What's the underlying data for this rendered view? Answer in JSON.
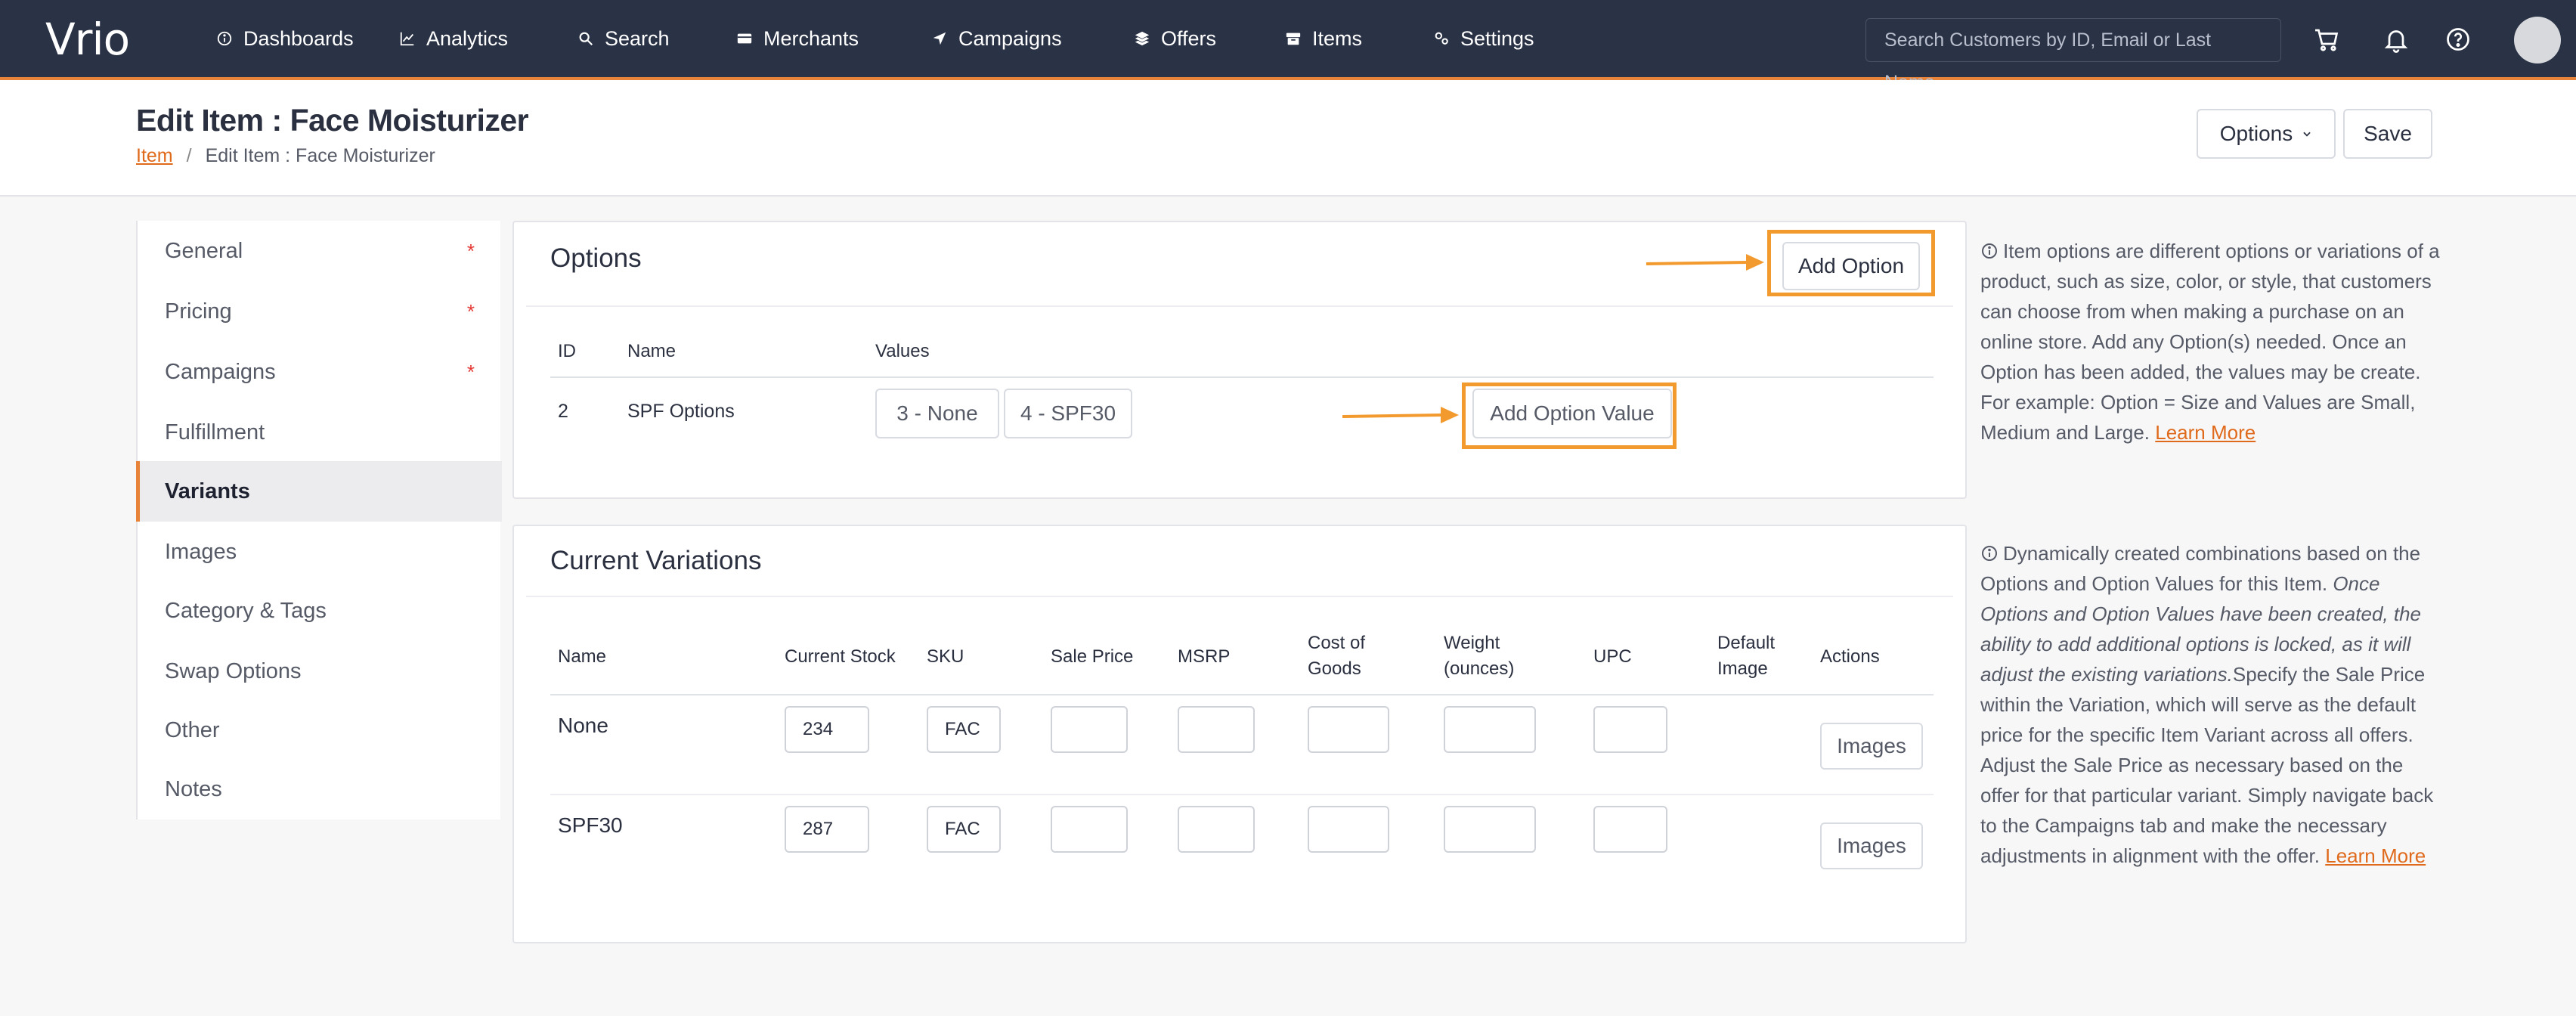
{
  "nav": {
    "logo": "Vrio",
    "items": [
      {
        "label": "Dashboards",
        "icon": "info-circle-icon"
      },
      {
        "label": "Analytics",
        "icon": "line-chart-icon"
      },
      {
        "label": "Search",
        "icon": "search-icon"
      },
      {
        "label": "Merchants",
        "icon": "card-icon"
      },
      {
        "label": "Campaigns",
        "icon": "paper-plane-icon"
      },
      {
        "label": "Offers",
        "icon": "layers-icon"
      },
      {
        "label": "Items",
        "icon": "box-icon"
      },
      {
        "label": "Settings",
        "icon": "gears-icon"
      }
    ],
    "active": "Items",
    "search_placeholder": "Search Customers by ID, Email or Last Name",
    "accent": "#e8833a",
    "background": "#2a3246"
  },
  "header": {
    "title": "Edit Item : Face Moisturizer",
    "breadcrumb_link": "Item",
    "breadcrumb_separator": "/",
    "breadcrumb_current": "Edit Item : Face Moisturizer",
    "options_label": "Options",
    "save_label": "Save"
  },
  "sidebar": {
    "items": [
      {
        "label": "General",
        "required": "*"
      },
      {
        "label": "Pricing",
        "required": "*"
      },
      {
        "label": "Campaigns",
        "required": "*"
      },
      {
        "label": "Fulfillment"
      },
      {
        "label": "Variants"
      },
      {
        "label": "Images"
      },
      {
        "label": "Category & Tags"
      },
      {
        "label": "Swap Options"
      },
      {
        "label": "Other"
      },
      {
        "label": "Notes"
      }
    ],
    "active": "Variants"
  },
  "options_panel": {
    "title": "Options",
    "add_option_label": "Add Option",
    "columns": [
      "ID",
      "Name",
      "Values"
    ],
    "rows": [
      {
        "id": "2",
        "name": "SPF Options",
        "values": [
          "3 - None",
          "4 - SPF30"
        ],
        "add_value_label": "Add Option Value"
      }
    ]
  },
  "variations_panel": {
    "title": "Current Variations",
    "columns": [
      "Name",
      "Current Stock",
      "SKU",
      "Sale Price",
      "MSRP",
      "Cost of Goods",
      "Weight (ounces)",
      "UPC",
      "Default Image",
      "Actions"
    ],
    "rows": [
      {
        "name": "None",
        "stock": "234",
        "sku": "FAC",
        "sale_price": "",
        "msrp": "",
        "cost": "",
        "weight": "",
        "upc": "",
        "action_label": "Images"
      },
      {
        "name": "SPF30",
        "stock": "287",
        "sku": "FAC",
        "sale_price": "",
        "msrp": "",
        "cost": "",
        "weight": "",
        "upc": "",
        "action_label": "Images"
      }
    ]
  },
  "help": {
    "options_text": "Item options are different options or variations of a product, such as size, color, or style, that customers can choose from when making a purchase on an online store. Add any Option(s) needed. Once an Option has been added, the values may be create. For example: Option = Size and Values are Small, Medium and Large.",
    "options_link": "Learn More",
    "variations_text_1": "Dynamically created combinations based on the Options and Option Values for this Item.",
    "variations_text_italic": "Once Options and Option Values have been created, the ability to add additional options is locked, as it will adjust the existing variations.",
    "variations_text_2": "Specify the Sale Price within the Variation, which will serve as the default price for the specific Item Variant across all offers. Adjust the Sale Price as necessary based on the offer for that particular variant. Simply navigate back to the Campaigns tab and make the necessary adjustments in alignment with the offer.",
    "variations_link": "Learn More"
  },
  "highlight_color": "#f29a2e"
}
